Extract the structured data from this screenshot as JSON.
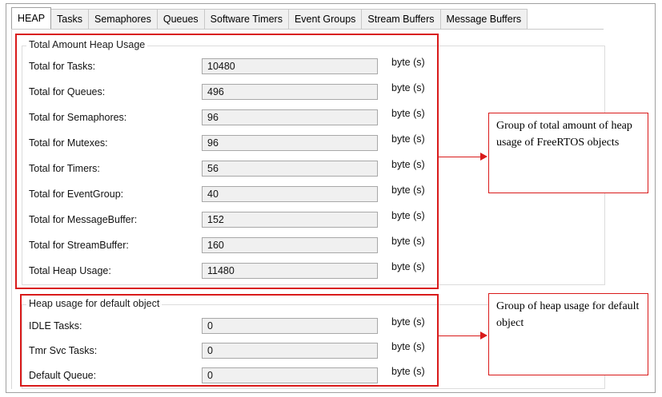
{
  "tabs": [
    "HEAP",
    "Tasks",
    "Semaphores",
    "Queues",
    "Software Timers",
    "Event Groups",
    "Stream Buffers",
    "Message Buffers"
  ],
  "total_group": {
    "title": "Total Amount Heap Usage",
    "rows": [
      {
        "label": "Total for Tasks:",
        "value": "10480",
        "unit": "byte (s)"
      },
      {
        "label": "Total for Queues:",
        "value": "496",
        "unit": "byte (s)"
      },
      {
        "label": "Total for Semaphores:",
        "value": "96",
        "unit": "byte (s)"
      },
      {
        "label": "Total for Mutexes:",
        "value": "96",
        "unit": "byte (s)"
      },
      {
        "label": "Total for Timers:",
        "value": "56",
        "unit": "byte (s)"
      },
      {
        "label": "Total for EventGroup:",
        "value": "40",
        "unit": "byte (s)"
      },
      {
        "label": "Total for MessageBuffer:",
        "value": "152",
        "unit": "byte (s)"
      },
      {
        "label": "Total for StreamBuffer:",
        "value": "160",
        "unit": "byte (s)"
      },
      {
        "label": "Total Heap Usage:",
        "value": "11480",
        "unit": "byte (s)"
      }
    ]
  },
  "default_group": {
    "title": "Heap usage for default object",
    "rows": [
      {
        "label": "IDLE Tasks:",
        "value": "0",
        "unit": "byte (s)"
      },
      {
        "label": "Tmr Svc Tasks:",
        "value": "0",
        "unit": "byte (s)"
      },
      {
        "label": "Default Queue:",
        "value": "0",
        "unit": "byte (s)"
      }
    ]
  },
  "callouts": {
    "total": "Group of total amount of heap usage of FreeRTOS objects",
    "default": "Group of heap usage for default object"
  },
  "colors": {
    "annotation": "#d91a1a",
    "field_bg": "#f0f0f0"
  }
}
